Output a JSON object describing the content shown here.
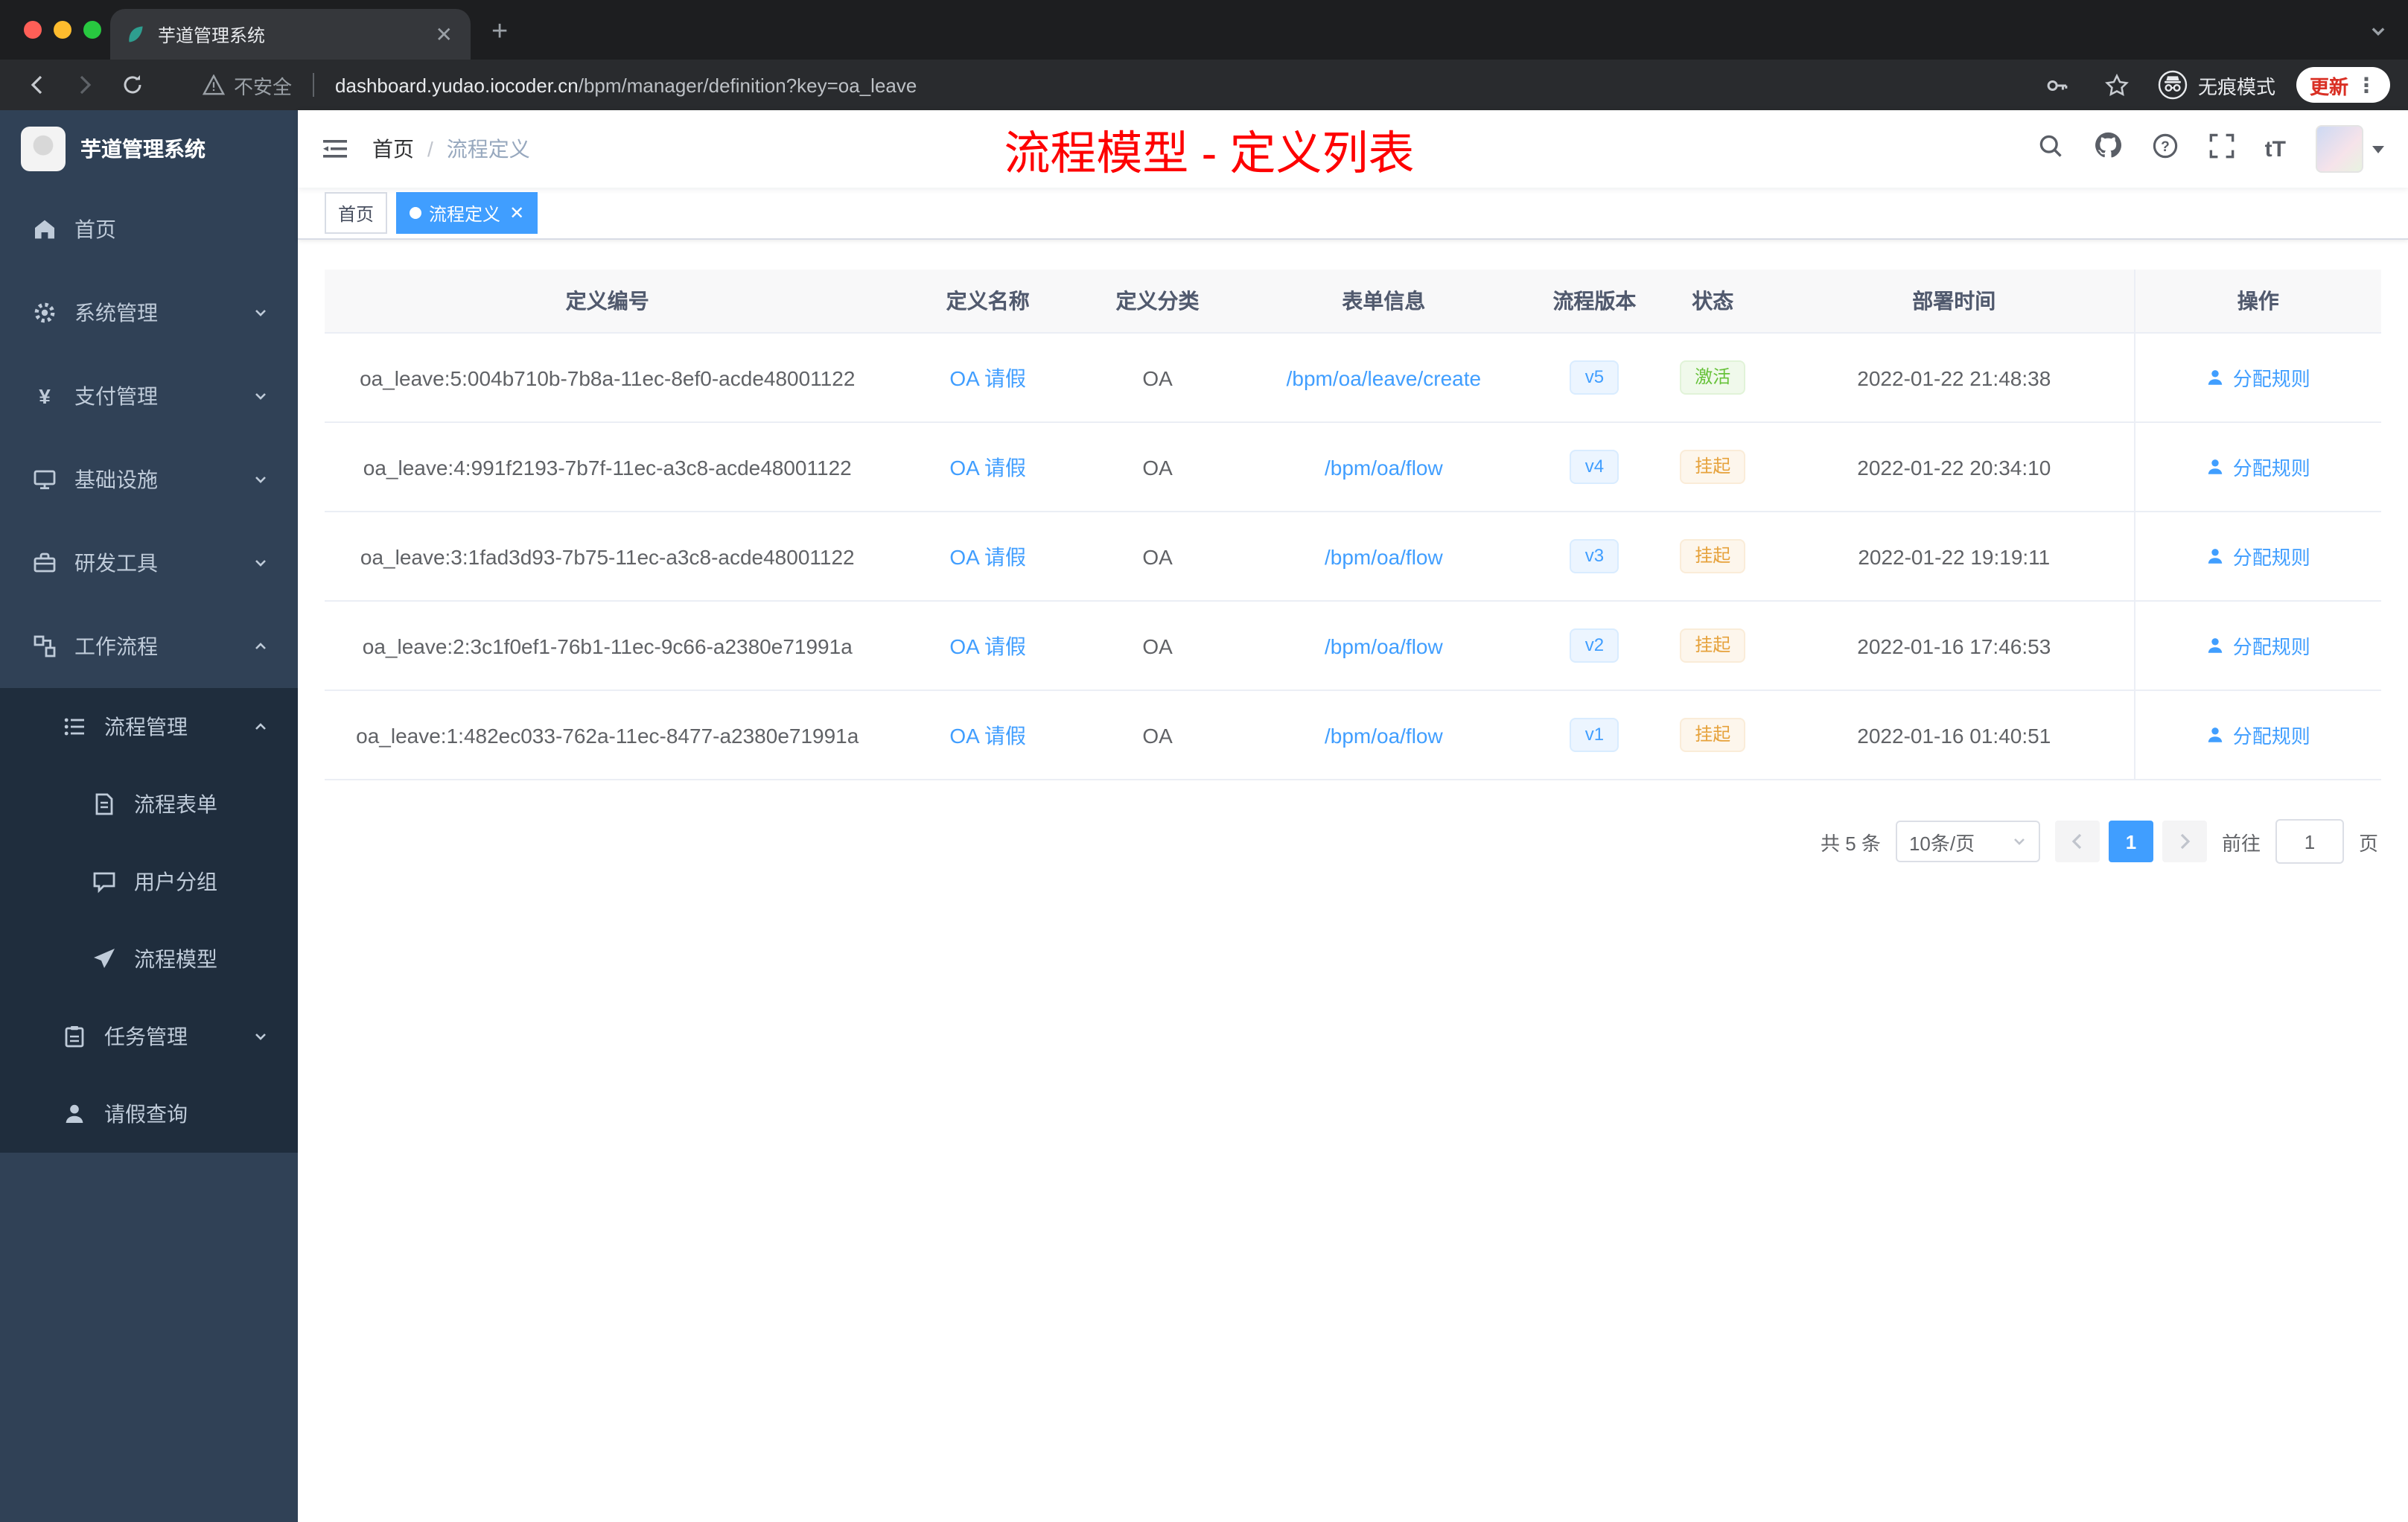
{
  "browser": {
    "tab_title": "芋道管理系统",
    "security_label": "不安全",
    "url_host": "dashboard.yudao.iocoder.cn",
    "url_path": "/bpm/manager/definition?key=oa_leave",
    "incognito_label": "无痕模式",
    "update_button": "更新"
  },
  "sidebar": {
    "logo_title": "芋道管理系统",
    "menu": [
      {
        "label": "首页"
      },
      {
        "label": "系统管理"
      },
      {
        "label": "支付管理"
      },
      {
        "label": "基础设施"
      },
      {
        "label": "研发工具"
      },
      {
        "label": "工作流程"
      }
    ],
    "submenu": {
      "process": {
        "label": "流程管理",
        "children": [
          {
            "label": "流程表单"
          },
          {
            "label": "用户分组"
          },
          {
            "label": "流程模型"
          }
        ]
      },
      "task": {
        "label": "任务管理"
      },
      "leave": {
        "label": "请假查询"
      }
    }
  },
  "header": {
    "breadcrumb_home": "首页",
    "breadcrumb_current": "流程定义",
    "annotation": "流程模型 - 定义列表"
  },
  "tags": {
    "items": [
      {
        "label": "首页",
        "active": false
      },
      {
        "label": "流程定义",
        "active": true
      }
    ]
  },
  "table": {
    "columns": [
      "定义编号",
      "定义名称",
      "定义分类",
      "表单信息",
      "流程版本",
      "状态",
      "部署时间",
      "操作"
    ],
    "rows": [
      {
        "id": "oa_leave:5:004b710b-7b8a-11ec-8ef0-acde48001122",
        "name": "OA 请假",
        "category": "OA",
        "form": "/bpm/oa/leave/create",
        "version": "v5",
        "status": "激活",
        "status_type": "success",
        "deploy_time": "2022-01-22 21:48:38",
        "action": "分配规则"
      },
      {
        "id": "oa_leave:4:991f2193-7b7f-11ec-a3c8-acde48001122",
        "name": "OA 请假",
        "category": "OA",
        "form": "/bpm/oa/flow",
        "version": "v4",
        "status": "挂起",
        "status_type": "warning",
        "deploy_time": "2022-01-22 20:34:10",
        "action": "分配规则"
      },
      {
        "id": "oa_leave:3:1fad3d93-7b75-11ec-a3c8-acde48001122",
        "name": "OA 请假",
        "category": "OA",
        "form": "/bpm/oa/flow",
        "version": "v3",
        "status": "挂起",
        "status_type": "warning",
        "deploy_time": "2022-01-22 19:19:11",
        "action": "分配规则"
      },
      {
        "id": "oa_leave:2:3c1f0ef1-76b1-11ec-9c66-a2380e71991a",
        "name": "OA 请假",
        "category": "OA",
        "form": "/bpm/oa/flow",
        "version": "v2",
        "status": "挂起",
        "status_type": "warning",
        "deploy_time": "2022-01-16 17:46:53",
        "action": "分配规则"
      },
      {
        "id": "oa_leave:1:482ec033-762a-11ec-8477-a2380e71991a",
        "name": "OA 请假",
        "category": "OA",
        "form": "/bpm/oa/flow",
        "version": "v1",
        "status": "挂起",
        "status_type": "warning",
        "deploy_time": "2022-01-16 01:40:51",
        "action": "分配规则"
      }
    ]
  },
  "pagination": {
    "total": "共 5 条",
    "page_size": "10条/页",
    "current_page": "1",
    "goto": "前往",
    "goto_value": "1",
    "unit": "页"
  },
  "colors": {
    "accent": "#409eff",
    "success": "#67c23a",
    "warning": "#e6a23c",
    "annotation_red": "#fe0000",
    "sidebar_bg": "#304156",
    "submenu_bg": "#1f2d3d"
  }
}
